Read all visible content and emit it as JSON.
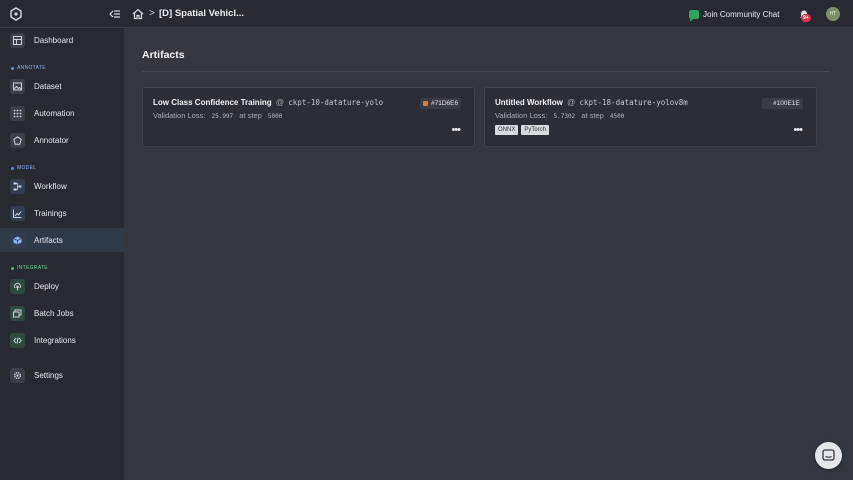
{
  "breadcrumb": {
    "separator": ">",
    "title": "[D] Spatial Vehicl..."
  },
  "header": {
    "community_label": "Join Community Chat",
    "notification_count": "9+",
    "avatar_initials": "HT"
  },
  "sidebar": {
    "items": [
      {
        "label": "Dashboard",
        "icon": "dashboard-icon"
      },
      {
        "label": "Dataset",
        "icon": "image-icon"
      },
      {
        "label": "Automation",
        "icon": "grid-icon"
      },
      {
        "label": "Annotator",
        "icon": "pen-icon"
      },
      {
        "label": "Workflow",
        "icon": "workflow-icon"
      },
      {
        "label": "Trainings",
        "icon": "chart-icon"
      },
      {
        "label": "Artifacts",
        "icon": "cube-icon"
      },
      {
        "label": "Deploy",
        "icon": "upload-icon"
      },
      {
        "label": "Batch Jobs",
        "icon": "batch-icon"
      },
      {
        "label": "Integrations",
        "icon": "code-icon"
      },
      {
        "label": "Settings",
        "icon": "gear-icon"
      }
    ],
    "sections": {
      "annotate": "ANNOTATE",
      "model": "MODEL",
      "integrate": "INTEGRATE"
    },
    "active": "Artifacts"
  },
  "main": {
    "title": "Artifacts",
    "cards": [
      {
        "name": "Low Class Confidence Training",
        "at": "@",
        "checkpoint": "ckpt-10-datature-yolo",
        "metric_label": "Validation Loss:",
        "metric_value": "25.997",
        "step_label": "at step",
        "step_value": "5000",
        "hash": "#71D6E6",
        "swatch_color": "#d4823e",
        "tags": []
      },
      {
        "name": "Untitled Workflow",
        "at": "@",
        "checkpoint": "ckpt-18-datature-yolov8m",
        "metric_label": "Validation Loss:",
        "metric_value": "5.7302",
        "step_label": "at step",
        "step_value": "4500",
        "hash": "#100E1E",
        "swatch_color": "#3a3d46",
        "tags": [
          "ONNX",
          "PyTorch"
        ]
      }
    ],
    "more_label": "•••"
  },
  "colors": {
    "active_bg": "#2f3a48",
    "annotate_dot": "#5b8def",
    "integrate_dot": "#3fbf74",
    "community": "#2fa35b"
  }
}
